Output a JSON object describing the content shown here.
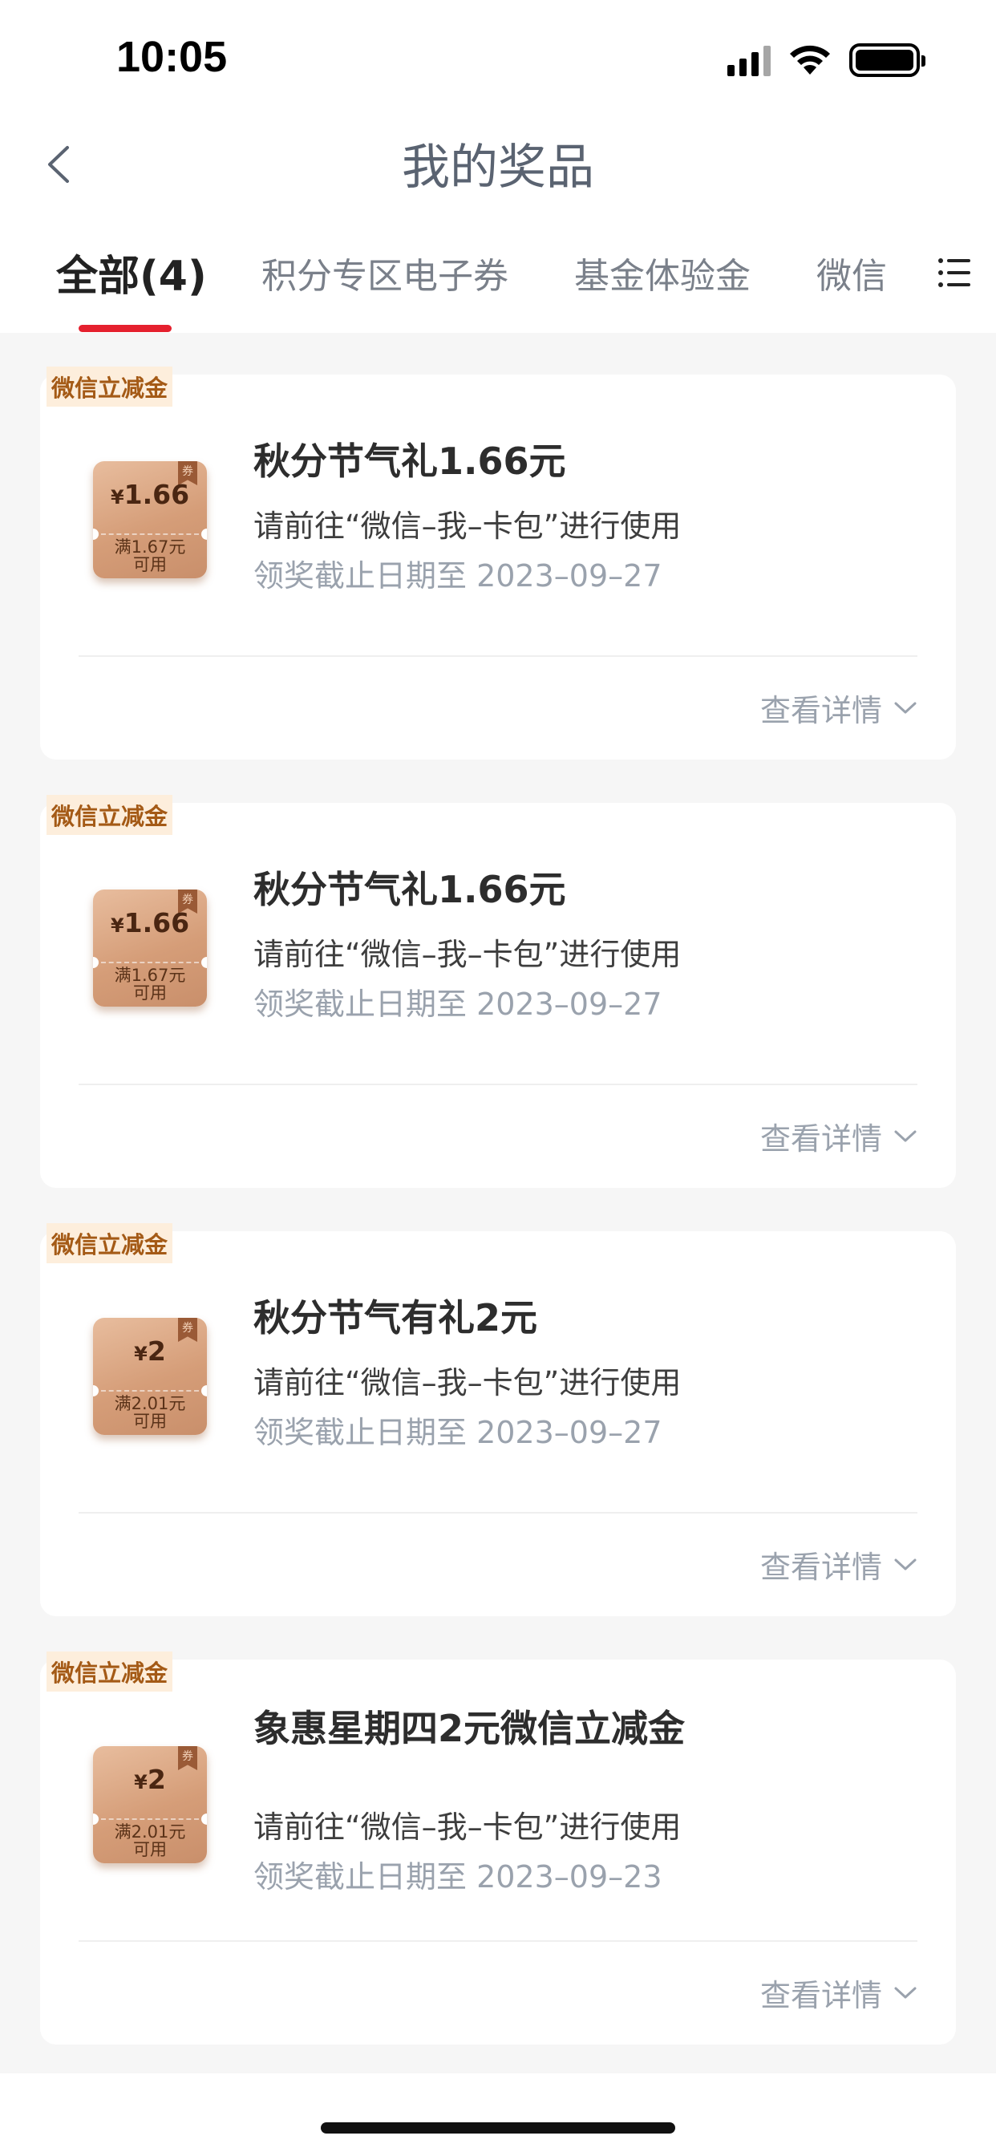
{
  "status_bar": {
    "time": "10:05"
  },
  "nav": {
    "title": "我的奖品"
  },
  "tabs": [
    {
      "label": "全部(4)",
      "active": true
    },
    {
      "label": "积分专区电子券",
      "active": false
    },
    {
      "label": "基金体验金",
      "active": false
    },
    {
      "label": "微信",
      "active": false
    }
  ],
  "colors": {
    "accent": "#e5202e",
    "badge_text": "#a45a16",
    "badge_bg": "#fdeedc"
  },
  "prizes": [
    {
      "badge": "微信立减金",
      "coupon_amount": "1.66",
      "coupon_threshold_line1": "满1.67元",
      "coupon_threshold_line2": "可用",
      "title": "秋分节气礼1.66元",
      "description": "请前往“微信–我–卡包”进行使用",
      "deadline": "领奖截止日期至 2023–09–27",
      "details_label": "查看详情"
    },
    {
      "badge": "微信立减金",
      "coupon_amount": "1.66",
      "coupon_threshold_line1": "满1.67元",
      "coupon_threshold_line2": "可用",
      "title": "秋分节气礼1.66元",
      "description": "请前往“微信–我–卡包”进行使用",
      "deadline": "领奖截止日期至 2023–09–27",
      "details_label": "查看详情"
    },
    {
      "badge": "微信立减金",
      "coupon_amount": "2",
      "coupon_threshold_line1": "满2.01元",
      "coupon_threshold_line2": "可用",
      "title": "秋分节气有礼2元",
      "description": "请前往“微信–我–卡包”进行使用",
      "deadline": "领奖截止日期至 2023–09–27",
      "details_label": "查看详情"
    },
    {
      "badge": "微信立减金",
      "coupon_amount": "2",
      "coupon_threshold_line1": "满2.01元",
      "coupon_threshold_line2": "可用",
      "title": "象惠星期四2元微信立减金",
      "description": "请前往“微信–我–卡包”进行使用",
      "deadline": "领奖截止日期至 2023–09–23",
      "details_label": "查看详情"
    }
  ],
  "coupon_ribbon": "券",
  "currency_symbol": "¥"
}
